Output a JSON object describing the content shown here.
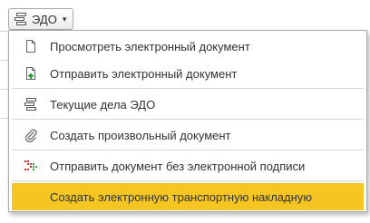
{
  "edo_button": {
    "label": "ЭДО",
    "icon": "edo-tasks-icon",
    "caret": "▾"
  },
  "menu": {
    "items": [
      {
        "label": "Просмотреть электронный документ",
        "icon": "document-icon"
      },
      {
        "label": "Отправить электронный документ",
        "icon": "send-document-icon"
      },
      {
        "label": "Текущие дела ЭДО",
        "icon": "edo-tasks-icon"
      },
      {
        "label": "Создать произвольный документ",
        "icon": "paperclip-icon"
      },
      {
        "label": "Отправить документ без электронной подписи",
        "icon": "dotted-arrow-icon"
      },
      {
        "label": "Создать электронную транспортную накладную",
        "icon": "",
        "highlighted": true
      }
    ]
  },
  "colors": {
    "highlight": "#f5c521",
    "send_arrow": "#2e9b38",
    "dotted_arrow_red": "#d2322d",
    "dotted_arrow_green": "#3fa54a"
  }
}
